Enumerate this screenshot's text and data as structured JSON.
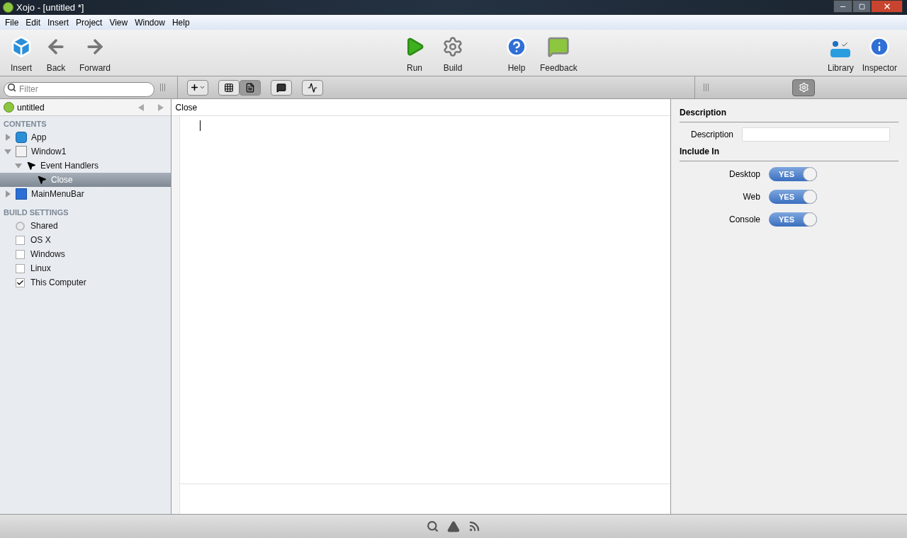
{
  "window": {
    "title": "Xojo - [untitled *]"
  },
  "menu": [
    "File",
    "Edit",
    "Insert",
    "Project",
    "View",
    "Window",
    "Help"
  ],
  "toolbar": {
    "left": [
      {
        "kind": "insert",
        "label": "Insert"
      },
      {
        "kind": "back",
        "label": "Back"
      },
      {
        "kind": "forward",
        "label": "Forward"
      }
    ],
    "center": [
      {
        "kind": "run",
        "label": "Run"
      },
      {
        "kind": "build",
        "label": "Build"
      }
    ],
    "help": [
      {
        "kind": "help",
        "label": "Help"
      },
      {
        "kind": "feedback",
        "label": "Feedback"
      }
    ],
    "right": [
      {
        "kind": "library",
        "label": "Library"
      },
      {
        "kind": "inspector",
        "label": "Inspector"
      }
    ]
  },
  "filter": {
    "placeholder": "Filter"
  },
  "editor_tools": [
    {
      "kind": "add",
      "selected": false
    },
    {
      "kind": "grid",
      "selected": false
    },
    {
      "kind": "code",
      "selected": true
    },
    {
      "kind": "comment",
      "selected": false
    },
    {
      "kind": "wave",
      "selected": false
    }
  ],
  "navigator": {
    "project": "untitled",
    "sections": [
      {
        "title": "CONTENTS",
        "items": [
          {
            "kind": "app",
            "label": "App",
            "expanded": false,
            "selected": false
          },
          {
            "kind": "window",
            "label": "Window1",
            "expanded": true,
            "selected": false,
            "children": [
              {
                "kind": "events",
                "label": "Event Handlers",
                "expanded": true,
                "selected": false,
                "children": [
                  {
                    "kind": "event",
                    "label": "Close",
                    "selected": true
                  }
                ]
              }
            ]
          },
          {
            "kind": "menubar",
            "label": "MainMenuBar",
            "expanded": false,
            "selected": false
          }
        ]
      },
      {
        "title": "BUILD SETTINGS",
        "items": [
          {
            "kind": "shared",
            "label": "Shared"
          },
          {
            "kind": "checkbox",
            "label": "OS X",
            "checked": false
          },
          {
            "kind": "checkbox",
            "label": "Windows",
            "checked": false
          },
          {
            "kind": "checkbox",
            "label": "Linux",
            "checked": false
          },
          {
            "kind": "checkbox",
            "label": "This Computer",
            "checked": true
          }
        ]
      }
    ]
  },
  "editor": {
    "breadcrumb": "Close"
  },
  "inspector": {
    "sections": [
      {
        "title": "Description",
        "rows": [
          {
            "kind": "field",
            "label": "Description"
          }
        ]
      },
      {
        "title": "Include In",
        "rows": [
          {
            "kind": "toggle",
            "label": "Desktop",
            "on": true,
            "text": "YES"
          },
          {
            "kind": "toggle",
            "label": "Web",
            "on": true,
            "text": "YES"
          },
          {
            "kind": "toggle",
            "label": "Console",
            "on": true,
            "text": "YES"
          }
        ]
      }
    ]
  }
}
